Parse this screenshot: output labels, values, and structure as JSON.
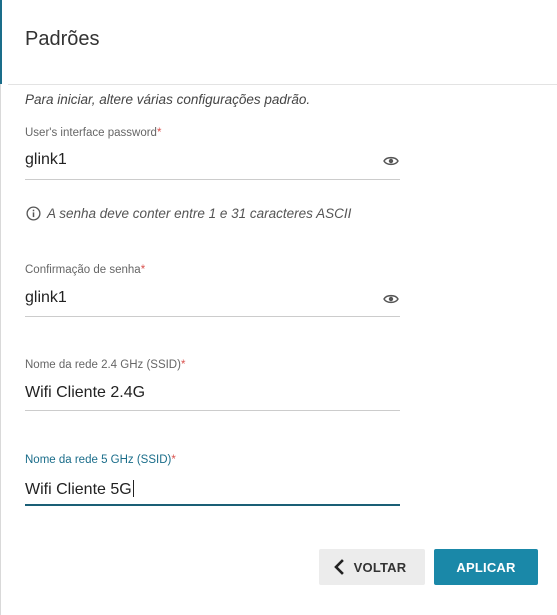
{
  "header": {
    "title": "Padrões"
  },
  "intro": "Para iniciar, altere várias configurações padrão.",
  "fields": {
    "password": {
      "label": "User's interface password",
      "required_mark": "*",
      "value": "glink1",
      "icon": "eye-icon"
    },
    "password_hint": {
      "icon": "info-icon",
      "text": "A senha deve conter entre 1 e 31 caracteres ASCII"
    },
    "confirm": {
      "label": "Confirmação de senha",
      "required_mark": "*",
      "value": "glink1",
      "icon": "eye-icon"
    },
    "ssid_24": {
      "label": "Nome da rede 2.4 GHz (SSID)",
      "required_mark": "*",
      "value": "Wifi Cliente 2.4G"
    },
    "ssid_5": {
      "label": "Nome da rede 5 GHz (SSID)",
      "required_mark": "*",
      "value": "Wifi Cliente 5G",
      "focused": true
    }
  },
  "actions": {
    "back_label": "VOLTAR",
    "back_icon": "chevron-left-icon",
    "apply_label": "APLICAR"
  },
  "colors": {
    "accent": "#1a88a8",
    "focus": "#1a5f76",
    "required": "#d9534f"
  }
}
